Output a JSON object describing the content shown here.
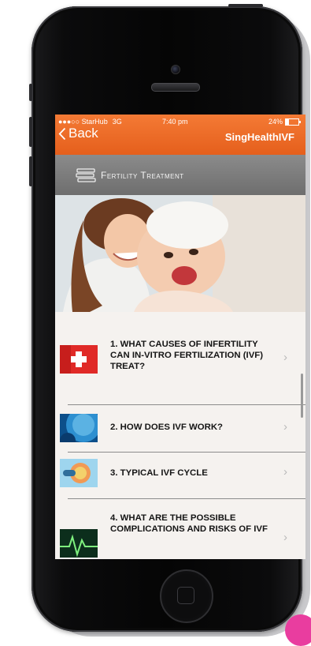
{
  "status_bar": {
    "carrier": "●●●○○ StarHub",
    "network": "3G",
    "time": "7:40 pm",
    "battery": "24%"
  },
  "nav": {
    "back_label": "Back",
    "brand_main": "SingHealth",
    "brand_suffix": "IVF"
  },
  "section": {
    "title": "Fertility Treatment",
    "icon": "books-icon"
  },
  "list": {
    "items": [
      {
        "label": "1. WHAT CAUSES OF INFERTILITY CAN IN-VITRO FERTILIZATION (IVF) TREAT?",
        "icon": "medical-cross-icon"
      },
      {
        "label": "2. HOW DOES IVF WORK?",
        "icon": "cell-icon"
      },
      {
        "label": "3. TYPICAL IVF CYCLE",
        "icon": "egg-cell-icon"
      },
      {
        "label": "4. WHAT ARE THE POSSIBLE COMPLICATIONS AND RISKS OF IVF",
        "icon": "heartbeat-icon"
      }
    ],
    "chevron": "›"
  },
  "colors": {
    "accent_orange": "#ef6b27",
    "header_gray": "#7b7b7b",
    "list_bg": "#f5f2ef"
  }
}
